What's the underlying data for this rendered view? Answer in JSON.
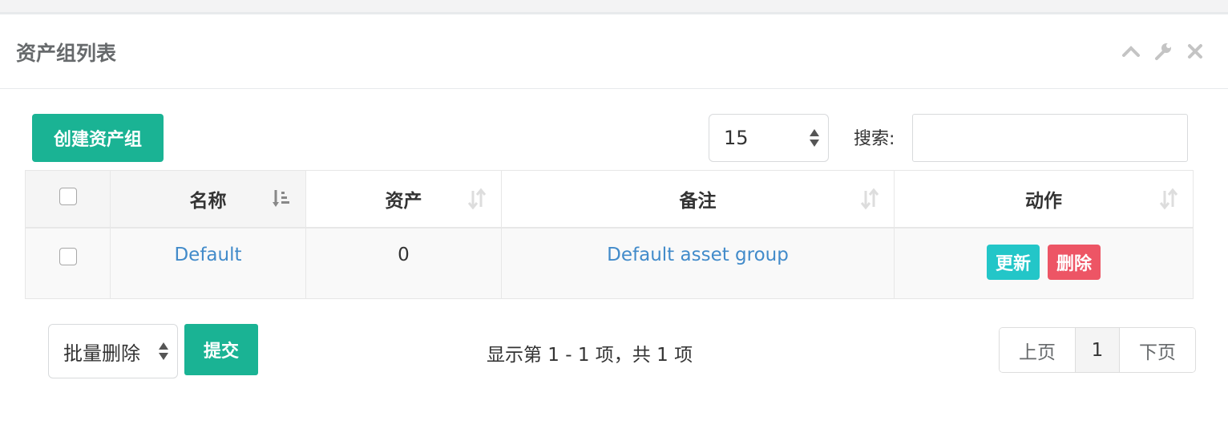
{
  "panel": {
    "title": "资产组列表"
  },
  "toolbar": {
    "create_label": "创建资产组",
    "page_size": "15",
    "search_label": "搜索:",
    "search_placeholder": ""
  },
  "table": {
    "columns": [
      "名称",
      "资产",
      "备注",
      "动作"
    ],
    "rows": [
      {
        "name": "Default",
        "assets": "0",
        "comment": "Default asset group",
        "actions": [
          "更新",
          "删除"
        ]
      }
    ]
  },
  "footer": {
    "bulk_action": "批量删除",
    "submit_label": "提交",
    "info": "显示第 1 - 1 项，共 1 项",
    "pagination": {
      "prev": "上页",
      "current": "1",
      "next": "下页"
    }
  },
  "colors": {
    "primary": "#1ab394",
    "info": "#23c6c8",
    "danger": "#ed5565",
    "link": "#428bca"
  },
  "icons": [
    "chevron-up-icon",
    "wrench-icon",
    "close-icon",
    "sort-asc-icon",
    "sort-both-icon",
    "select-arrows-icon"
  ]
}
